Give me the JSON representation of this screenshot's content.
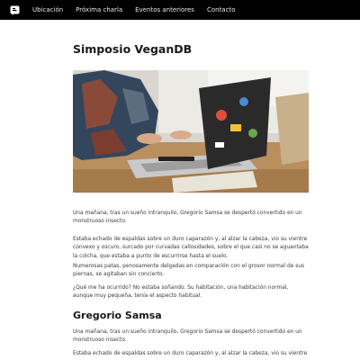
{
  "nav": {
    "links": [
      "Ubicación",
      "Próxima charla",
      "Eventos anteriores",
      "Contacto"
    ]
  },
  "main": {
    "title": "Simposio VeganDB",
    "paragraphs": [
      "Una mañana, tras un sueño intranquilo, Gregorio Samsa se despertó convertido en un monstruoso insecto.",
      "Estaba echado de espaldas sobre un duro caparazón y, al alzar la cabeza, vio su vientre convexo y oscuro, surcado por curvadas callosidades, sobre el que casi no se aguantaba la colcha, que estaba a punto de escurrirse hasta el suelo.",
      "Numerosas patas, penosamente delgadas en comparación con el grosor normal de sus piernas, se agitaban sin concierto.",
      "¿Qué me ha ocurrido? No estaba soñando. Su habitación, una habitación normal, aunque muy pequeña, tenía el aspecto habitual."
    ],
    "subtitle": "Gregorio Samsa",
    "sub_paragraphs": [
      "Una mañana, tras un sueño intranquilo, Gregorio Samsa se despertó convertido en un monstruoso insecto.",
      "Estaba echado de espaldas sobre un duro caparazón y, al alzar la cabeza, vio su vientre"
    ]
  },
  "icons": {
    "logo": "chat-bubble-logo-icon"
  },
  "colors": {
    "navbar": "#000000",
    "nav_text": "#e8e8e8",
    "heading": "#1a1a1a",
    "body_text": "#3a3a3a"
  }
}
